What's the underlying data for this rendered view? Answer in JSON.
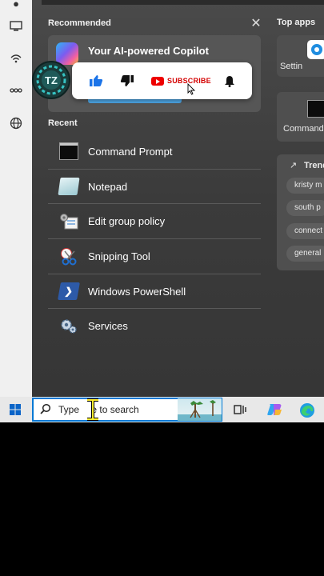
{
  "start_menu": {
    "recommended_title": "Recommended",
    "close_icon": "close-icon",
    "recommended_card": {
      "title": "Your AI-powered Copilot",
      "icon": "copilot-icon"
    },
    "recent_title": "Recent",
    "recent_items": [
      {
        "label": "Command Prompt",
        "icon": "command-prompt-icon"
      },
      {
        "label": "Notepad",
        "icon": "notepad-icon"
      },
      {
        "label": "Edit group policy",
        "icon": "group-policy-icon"
      },
      {
        "label": "Snipping Tool",
        "icon": "snipping-tool-icon"
      },
      {
        "label": "Windows PowerShell",
        "icon": "powershell-icon"
      },
      {
        "label": "Services",
        "icon": "services-icon"
      }
    ],
    "top_apps_title": "Top apps",
    "top_apps": [
      {
        "label": "Settin",
        "icon": "settings-icon"
      },
      {
        "label": "Command",
        "icon": "command-prompt-icon"
      }
    ],
    "trending_title": "Trend",
    "trending_chips": [
      "kristy m",
      "south p",
      "connect",
      "general"
    ]
  },
  "youtube_overlay": {
    "subscribe_label": "SUBSCRIBE",
    "channel_initials": "TZ"
  },
  "taskbar": {
    "search_placeholder": "Type here to search",
    "search_visible_start": "Type ",
    "search_visible_end": "e to search"
  },
  "colors": {
    "accent": "#0078d4",
    "youtube_red": "#e00000",
    "like_blue": "#1a73e8"
  }
}
